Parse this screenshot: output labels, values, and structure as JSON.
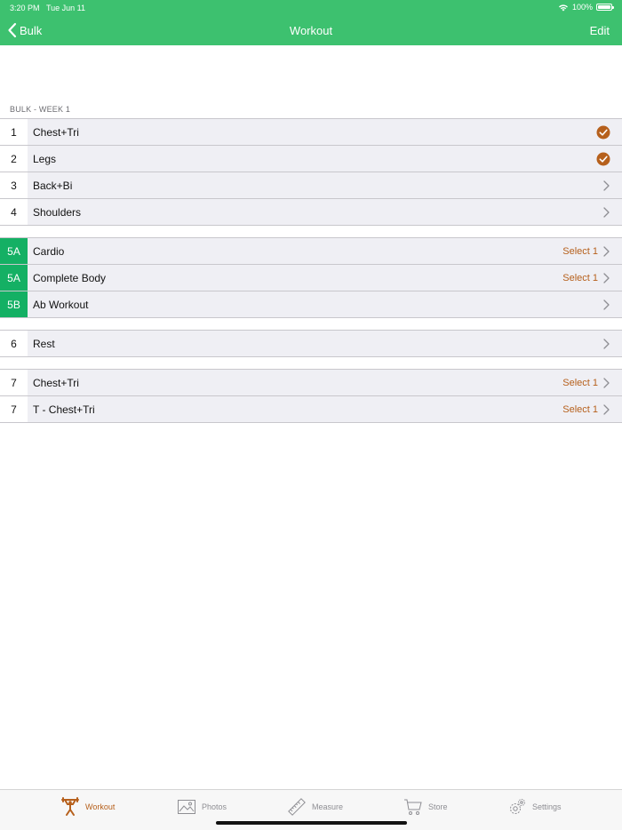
{
  "status_bar": {
    "time": "3:20 PM",
    "date": "Tue Jun 11",
    "battery": "100%"
  },
  "nav": {
    "back_label": "Bulk",
    "title": "Workout",
    "edit_label": "Edit"
  },
  "section_label": "BULK - WEEK 1",
  "groups": [
    {
      "rows": [
        {
          "num": "1",
          "name": "Chest+Tri",
          "trailing": "check"
        },
        {
          "num": "2",
          "name": "Legs",
          "trailing": "check"
        },
        {
          "num": "3",
          "name": "Back+Bi",
          "trailing": "chevron"
        },
        {
          "num": "4",
          "name": "Shoulders",
          "trailing": "chevron"
        }
      ]
    },
    {
      "rows": [
        {
          "num": "5A",
          "name": "Cardio",
          "trailing": "select",
          "select_text": "Select 1",
          "highlight": true
        },
        {
          "num": "5A",
          "name": "Complete Body",
          "trailing": "select",
          "select_text": "Select 1",
          "highlight": true
        },
        {
          "num": "5B",
          "name": "Ab Workout",
          "trailing": "chevron",
          "highlight": true
        }
      ]
    },
    {
      "rows": [
        {
          "num": "6",
          "name": "Rest",
          "trailing": "chevron"
        }
      ]
    },
    {
      "rows": [
        {
          "num": "7",
          "name": "Chest+Tri",
          "trailing": "select",
          "select_text": "Select 1"
        },
        {
          "num": "7",
          "name": "T - Chest+Tri",
          "trailing": "select",
          "select_text": "Select 1"
        }
      ]
    }
  ],
  "tabs": [
    {
      "label": "Workout",
      "icon": "weightlifter-icon",
      "active": true
    },
    {
      "label": "Photos",
      "icon": "photo-icon",
      "active": false
    },
    {
      "label": "Measure",
      "icon": "ruler-icon",
      "active": false
    },
    {
      "label": "Store",
      "icon": "cart-icon",
      "active": false
    },
    {
      "label": "Settings",
      "icon": "gear-icon",
      "active": false
    }
  ],
  "colors": {
    "header": "#3dc16f",
    "highlight": "#14b064",
    "accent": "#b6601c",
    "row_bg": "#efeff4"
  }
}
